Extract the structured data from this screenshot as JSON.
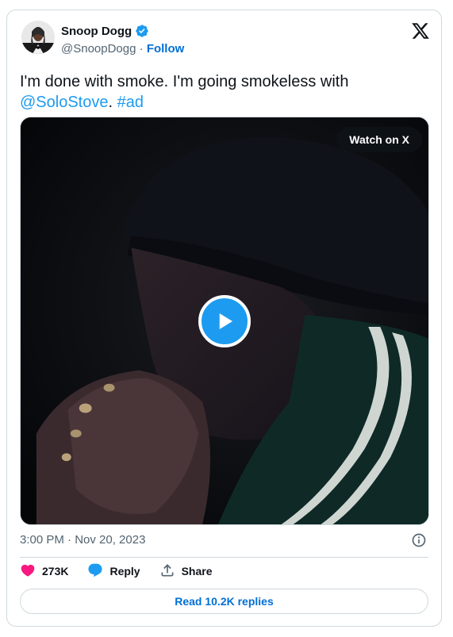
{
  "author": {
    "name": "Snoop Dogg",
    "handle": "@SnoopDogg",
    "separator": " · ",
    "follow_label": "Follow",
    "verified_color": "#1d9bf0"
  },
  "tweet": {
    "text_before": "I'm done with smoke. I'm going smokeless with ",
    "mention": "@SoloStove",
    "text_between": ". ",
    "hashtag": "#ad"
  },
  "media": {
    "watch_label": "Watch on X",
    "play_icon": "play-icon"
  },
  "meta": {
    "timestamp": "3:00 PM · Nov 20, 2023"
  },
  "actions": {
    "likes": "273K",
    "reply_label": "Reply",
    "share_label": "Share"
  },
  "read_replies_label": "Read 10.2K replies",
  "colors": {
    "link": "#1d9bf0",
    "follow": "#006fd6",
    "like": "#f91880",
    "muted": "#536471"
  }
}
